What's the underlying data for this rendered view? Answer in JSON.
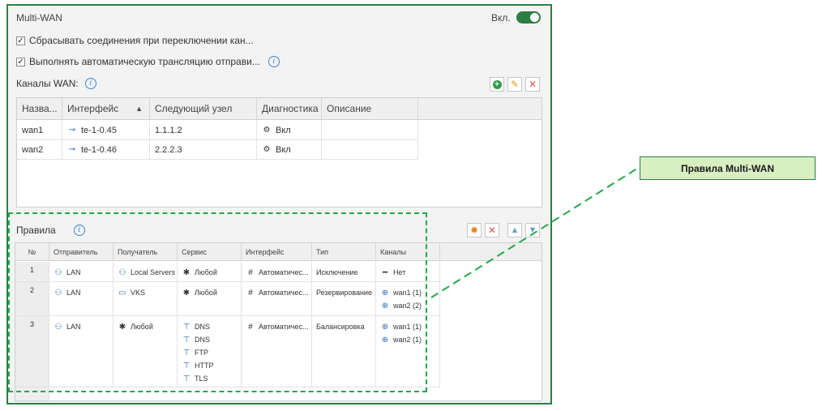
{
  "panel": {
    "title": "Multi-WAN",
    "toggle_label": "Вкл.",
    "toggle_on": true,
    "accent_color": "#2e7d45"
  },
  "options": [
    {
      "label": "Сбрасывать соединения при переключении кан...",
      "checked": true
    },
    {
      "label": "Выполнять автоматическую трансляцию отправи...",
      "checked": true
    }
  ],
  "wan_section": {
    "label": "Каналы WAN:",
    "toolbar": {
      "add_icon": "plus-circle-icon",
      "edit_icon": "pencil-icon",
      "delete_icon": "cross-icon"
    },
    "columns": [
      "Назва...",
      "Интерфейс",
      "Следующий узел",
      "Диагностика",
      "Описание"
    ],
    "sort_indicator": "▲",
    "rows": [
      {
        "name": "wan1",
        "interface": "te-1-0.45",
        "next_hop": "1.1.1.2",
        "diagnostics": "Вкл",
        "description": ""
      },
      {
        "name": "wan2",
        "interface": "te-1-0.46",
        "next_hop": "2.2.2.3",
        "diagnostics": "Вкл",
        "description": ""
      }
    ]
  },
  "rules_section": {
    "label": "Правила",
    "toolbar": {
      "settings_icon": "gear-icon",
      "delete_icon": "cross-icon",
      "up_icon": "arrow-up-icon",
      "down_icon": "arrow-down-icon"
    },
    "columns": [
      "№",
      "Отправитель",
      "Получатель",
      "Сервис",
      "Интерфейс",
      "Тип",
      "Каналы"
    ],
    "rows": [
      {
        "num": "1",
        "sender": "LAN",
        "receiver": "Local Servers",
        "services": [
          "Любой"
        ],
        "interface": "Автоматичес...",
        "type": "Исключение",
        "channels": [
          "Нет"
        ]
      },
      {
        "num": "2",
        "sender": "LAN",
        "receiver": "VKS",
        "services": [
          "Любой"
        ],
        "interface": "Автоматичес...",
        "type": "Резервирование",
        "channels": [
          "wan1 (1)",
          "wan2 (2)"
        ]
      },
      {
        "num": "3",
        "sender": "LAN",
        "receiver": "Любой",
        "services": [
          "DNS",
          "DNS",
          "FTP",
          "HTTP",
          "TLS"
        ],
        "interface": "Автоматичес...",
        "type": "Балансировка",
        "channels": [
          "wan1 (1)",
          "wan2 (1)"
        ]
      }
    ]
  },
  "callout": {
    "label": "Правила Multi-WAN"
  }
}
